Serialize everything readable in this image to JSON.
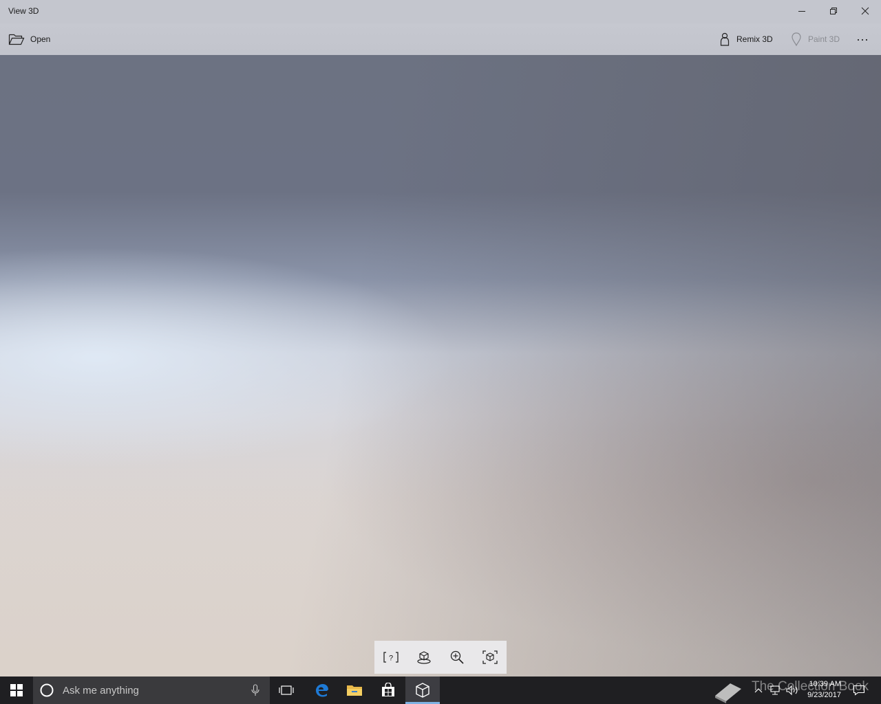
{
  "window": {
    "title": "View 3D"
  },
  "commandbar": {
    "open_label": "Open",
    "remix_label": "Remix 3D",
    "paint_label": "Paint 3D",
    "more_label": "···"
  },
  "viewport_toolbar": {
    "tools": [
      "question-frame-icon",
      "environment-icon",
      "zoom-in-icon",
      "fit-to-view-icon"
    ]
  },
  "taskbar": {
    "search_placeholder": "Ask me anything",
    "time": "10:39 AM",
    "date": "9/23/2017",
    "watermark": "The Collection Book",
    "pinned": [
      "task-view-icon",
      "edge-icon",
      "file-explorer-icon",
      "store-icon",
      "view-3d-icon"
    ],
    "active_app": "view-3d-icon"
  },
  "colors": {
    "accent_indicator": "#7fb2e3",
    "taskbar": "#1f1f22",
    "titlebar": "#c4c6ce"
  }
}
